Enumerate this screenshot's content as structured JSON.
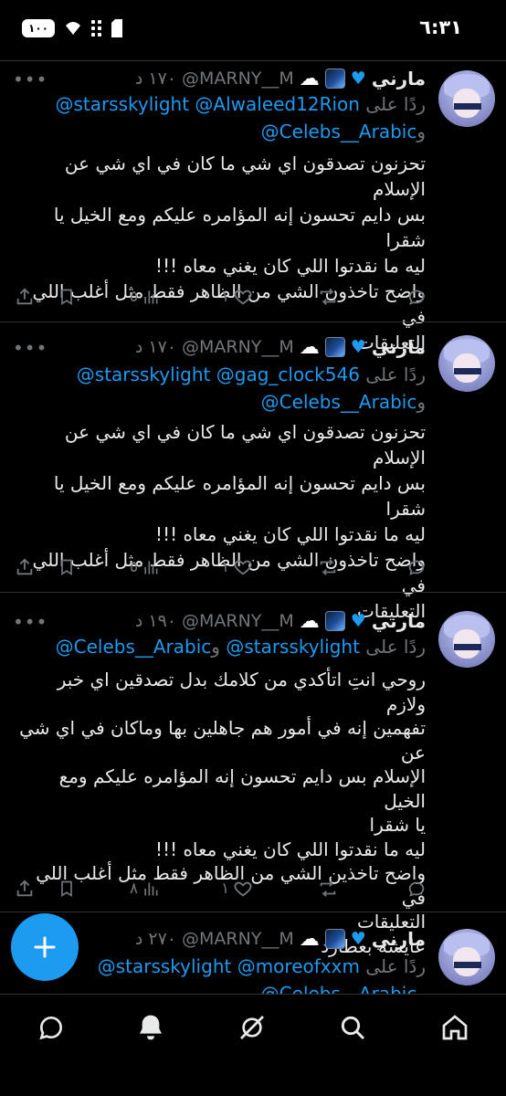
{
  "status_bar": {
    "time": "٦:٣١",
    "battery": "١٠٠"
  },
  "tweets": [
    {
      "name": "مارني",
      "handle": "@MARNY__M",
      "time": "١٧٠ د",
      "reply_prefix": "ردًا على",
      "reply_line1": "@starsskylight @Alwaleed12Rion",
      "reply_conj": "و",
      "reply_line2": "@Celebs__Arabic",
      "body": [
        "تحزنون تصدقون اي شي ما كان في اي شي عن الإسلام",
        "بس دايم تحسون إنه المؤامره عليكم ومع الخيل يا شقرا",
        "ليه ما نقدتوا اللي كان يغني معاه !!!",
        "واضح تاخذون الشي من الظاهر فقط مثل أغلب اللي في",
        "التعليقات"
      ],
      "likes": "١",
      "views": "٥"
    },
    {
      "name": "مارني",
      "handle": "@MARNY__M",
      "time": "١٧٠ د",
      "reply_prefix": "ردًا على",
      "reply_line1": "@starsskylight @gag_clock546",
      "reply_conj": "و",
      "reply_line2": "@Celebs__Arabic",
      "body": [
        "تحزنون تصدقون اي شي ما كان في اي شي عن الإسلام",
        "بس دايم تحسون إنه المؤامره عليكم ومع الخيل يا شقرا",
        "ليه ما نقدتوا اللي كان يغني معاه !!!",
        "واضح تاخذون الشي من الظاهر فقط مثل أغلب اللي في",
        "التعليقات"
      ],
      "likes": "١",
      "views": "٥"
    },
    {
      "name": "مارني",
      "handle": "@MARNY__M",
      "time": "١٩٠ د",
      "reply_prefix": "ردًا على",
      "reply_line1": "@starsskylight",
      "reply_conj": "و",
      "reply_line2": "@Celebs__Arabic",
      "body": [
        "روحي انتِ اتأكدي من كلامك بدل تصدقين اي خبر ولازم",
        "تفهمين إنه في أمور هم جاهلين بها وماكان في اي شي عن",
        "الإسلام بس دايم تحسون إنه المؤامره عليكم ومع الخيل",
        "يا شقرا",
        "ليه ما نقدتوا اللي كان يغني معاه !!!",
        "واضح تاخذين الشي من الظاهر فقط مثل أغلب اللي في",
        "التعليقات",
        "عايشه بعطارد"
      ],
      "likes": "١",
      "views": "٨"
    },
    {
      "name": "مارني",
      "handle": "@MARNY__M",
      "time": "٢٧٠ د",
      "reply_prefix": "ردًا على",
      "reply_line1": "@starsskylight @moreofxxm",
      "reply_conj": "و",
      "reply_line2": "@Celebs__Arabic",
      "body": [],
      "likes": "",
      "views": ""
    }
  ]
}
